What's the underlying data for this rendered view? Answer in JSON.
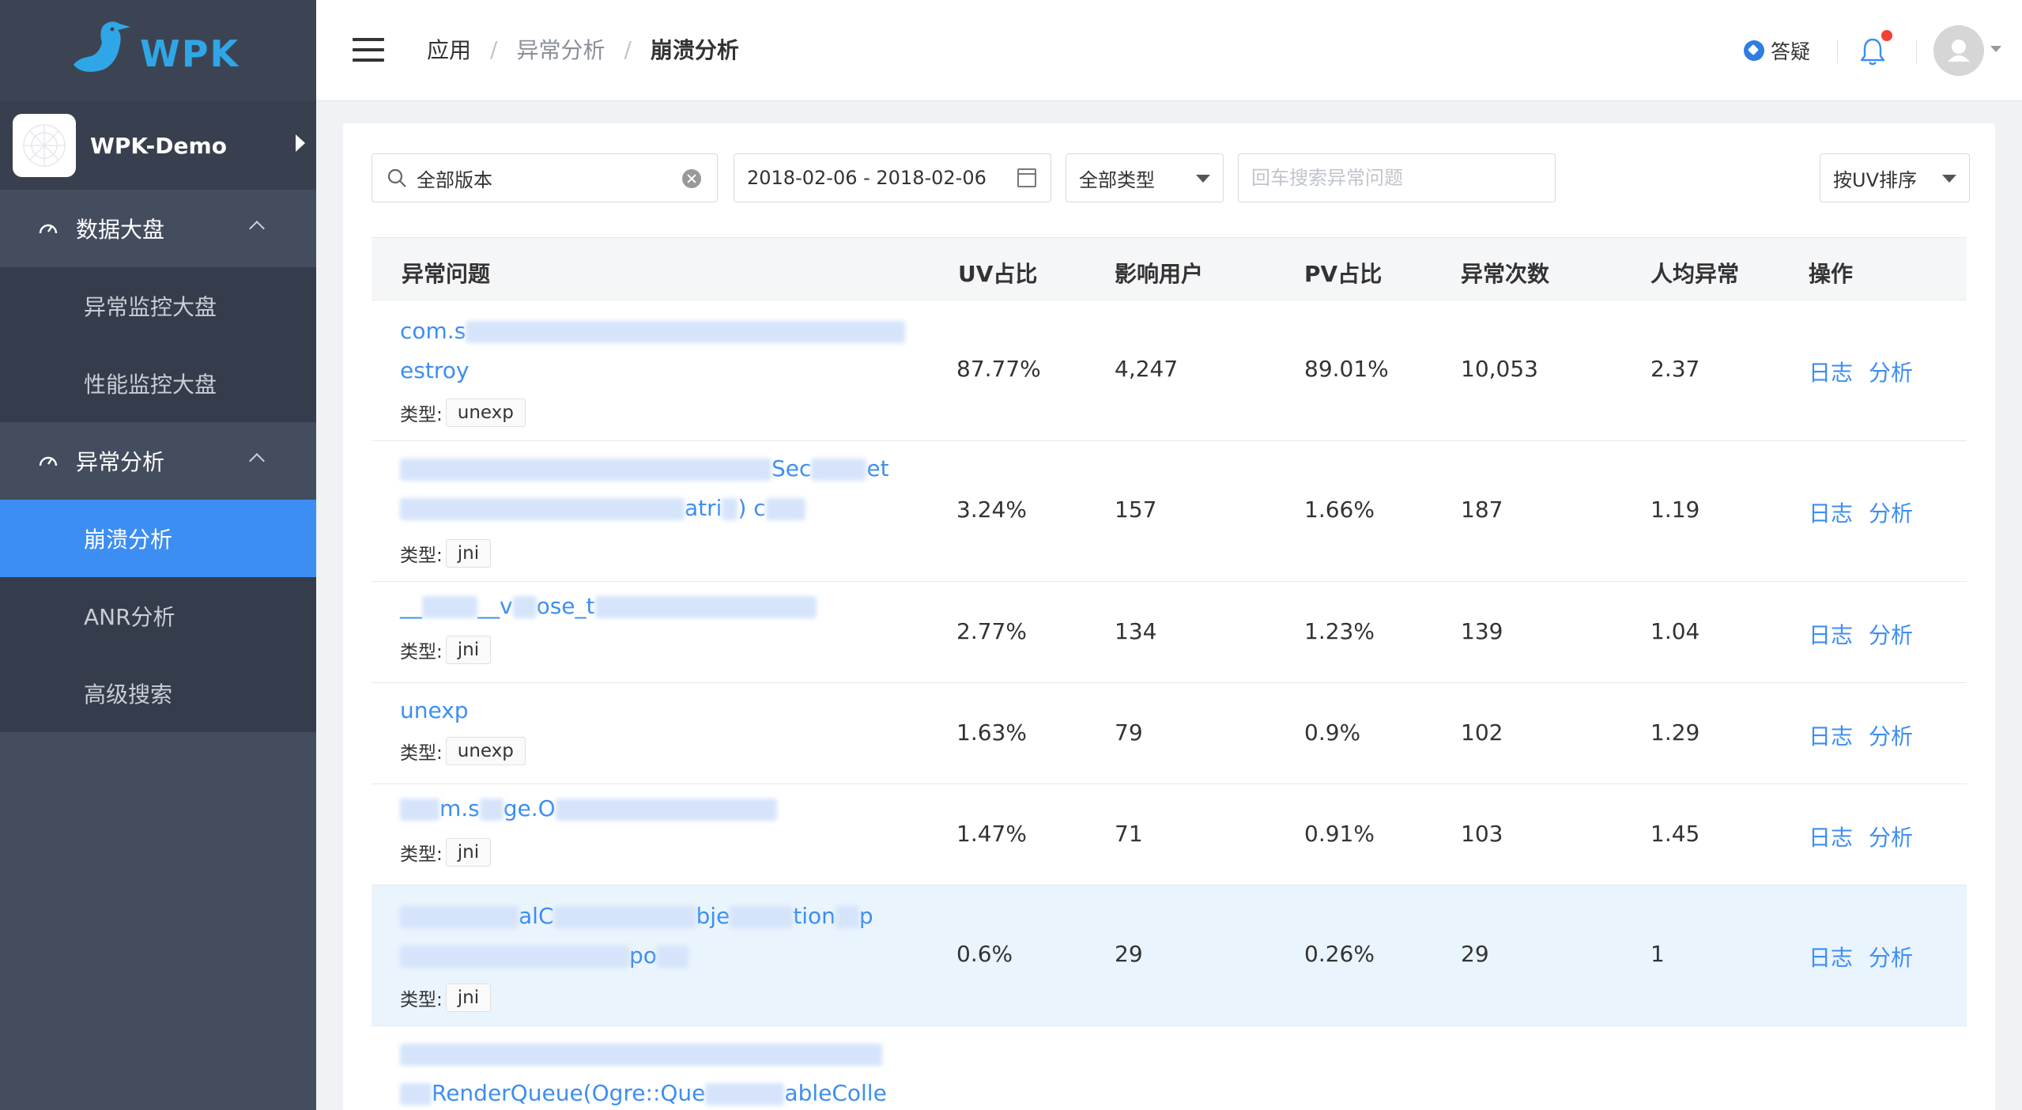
{
  "logo": {
    "text": "WPK"
  },
  "app": {
    "name": "WPK-Demo"
  },
  "sidebar": {
    "groups": [
      {
        "label": "数据大盘",
        "items": [
          "异常监控大盘",
          "性能监控大盘"
        ]
      },
      {
        "label": "异常分析",
        "items": [
          "崩溃分析",
          "ANR分析",
          "高级搜索"
        ],
        "active": "崩溃分析"
      }
    ]
  },
  "header": {
    "breadcrumb": [
      "应用",
      "异常分析",
      "崩溃分析"
    ],
    "breadcrumb_sep": "/",
    "help_label": "答疑"
  },
  "filters": {
    "version": "全部版本",
    "date_range": "2018-02-06 - 2018-02-06",
    "type": "全部类型",
    "search_placeholder": "回车搜索异常问题",
    "sort": "按UV排序"
  },
  "table": {
    "columns": [
      "异常问题",
      "UV占比",
      "影响用户",
      "PV占比",
      "异常次数",
      "人均异常",
      "操作"
    ],
    "type_prefix": "类型:",
    "actions": [
      "日志",
      "分析"
    ],
    "rows": [
      {
        "title_parts": [
          "com.s",
          "estroy"
        ],
        "type": "unexp",
        "uv": "87.77%",
        "users": "4,247",
        "pv": "89.01%",
        "count": "10,053",
        "avg": "2.37"
      },
      {
        "title_parts": [
          "Sec",
          "et",
          "atri",
          ") c"
        ],
        "type": "jni",
        "uv": "3.24%",
        "users": "157",
        "pv": "1.66%",
        "count": "187",
        "avg": "1.19"
      },
      {
        "title_parts": [
          "__",
          "__v",
          "ose_t"
        ],
        "type": "jni",
        "uv": "2.77%",
        "users": "134",
        "pv": "1.23%",
        "count": "139",
        "avg": "1.04"
      },
      {
        "title_parts": [
          "unexp"
        ],
        "type": "unexp",
        "uv": "1.63%",
        "users": "79",
        "pv": "0.9%",
        "count": "102",
        "avg": "1.29"
      },
      {
        "title_parts": [
          "m.s",
          "ge.O"
        ],
        "type": "jni",
        "uv": "1.47%",
        "users": "71",
        "pv": "0.91%",
        "count": "103",
        "avg": "1.45"
      },
      {
        "title_parts": [
          "alC",
          "bje",
          "tion",
          "p",
          "po"
        ],
        "type": "jni",
        "uv": "0.6%",
        "users": "29",
        "pv": "0.26%",
        "count": "29",
        "avg": "1"
      },
      {
        "title_parts": [
          "RenderQueue(Ogre::Que",
          "ableColle"
        ],
        "type": "",
        "uv": "",
        "users": "",
        "pv": "",
        "count": "",
        "avg": ""
      }
    ]
  },
  "colors": {
    "sidebar": "#444d5e",
    "active": "#3d8ef2",
    "link": "#3d8ef2",
    "highlight_row": "#eaf4fd"
  }
}
